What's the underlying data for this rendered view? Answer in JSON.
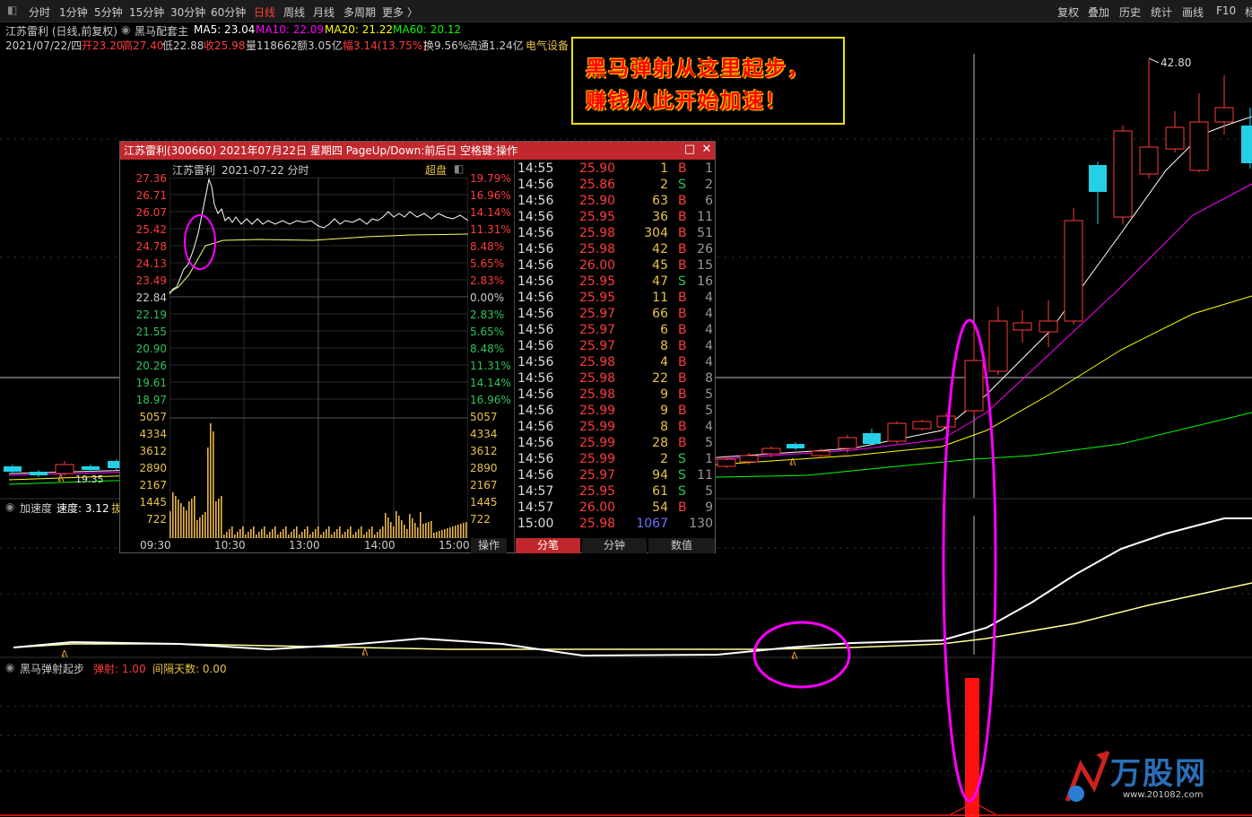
{
  "toolbar": {
    "left": [
      "分时",
      "1分钟",
      "5分钟",
      "15分钟",
      "30分钟",
      "60分钟",
      "日线",
      "周线",
      "月线",
      "多周期",
      "更多 〉"
    ],
    "right": [
      "复权",
      "叠加",
      "历史",
      "统计",
      "画线",
      "F10",
      "标"
    ],
    "active": "日线"
  },
  "info": {
    "title": "江苏雷利 (日线,前复权)",
    "formula": "黑马配套主",
    "ma5": "MA5: 23.04",
    "ma10": "MA10: 22.09",
    "ma20": "MA20: 21.22",
    "ma60": "MA60: 20.12",
    "date": "2021/07/22/四",
    "open": "开23.20",
    "high": "高27.40",
    "low": "低22.88",
    "close": "收25.98",
    "volume": "量118662",
    "amount": "额3.05亿",
    "range": "幅3.14(13.75%)",
    "turnover": "换9.56%",
    "float": "流通1.24亿",
    "sector": "电气设备"
  },
  "callout": {
    "line1": "黑马弹射从这里起步，",
    "line2": "赚钱从此开始加速！"
  },
  "chart_marks": {
    "peak": "42.80",
    "low": "19.35"
  },
  "panel2": {
    "title": "加速度",
    "speed": "速度: 3.12",
    "extra": "拔"
  },
  "panel3": {
    "title": "黑马弹射起步",
    "eject": "弹射: 1.00",
    "interval": "间隔天数: 0.00"
  },
  "colors": {
    "up": "#ff3b3b",
    "down": "#23d0e8",
    "ma5": "#ffffff",
    "ma10": "#ff00ff",
    "ma20": "#ffff00",
    "ma60": "#00ff00",
    "highlight": "#ff00ff"
  },
  "popup": {
    "title": "江苏雷利(300660) 2021年07月22日 星期四 PageUp/Down:前后日 空格键:操作",
    "header_name": "江苏雷利",
    "header_date": "2021-07-22 分时",
    "super_label": "超盘",
    "price_labels": [
      "27.36",
      "26.71",
      "26.07",
      "25.42",
      "24.78",
      "24.13",
      "23.49",
      "22.84",
      "22.19",
      "21.55",
      "20.90",
      "20.26",
      "19.61",
      "18.97"
    ],
    "pct_labels": [
      "19.79%",
      "16.96%",
      "14.14%",
      "11.31%",
      "8.48%",
      "5.65%",
      "2.83%",
      "0.00%",
      "2.83%",
      "5.65%",
      "8.48%",
      "11.31%",
      "14.14%",
      "16.96%"
    ],
    "volume_labels": [
      "5057",
      "4334",
      "3612",
      "2890",
      "2167",
      "1445",
      "722"
    ],
    "time_labels": [
      "09:30",
      "10:30",
      "13:00",
      "14:00",
      "15:00"
    ],
    "operate": "操作",
    "tabs": [
      "分笔",
      "分钟",
      "数值"
    ],
    "trades": [
      [
        "14:55",
        "25.90",
        "1",
        "B",
        "1"
      ],
      [
        "14:56",
        "25.86",
        "2",
        "S",
        "2"
      ],
      [
        "14:56",
        "25.90",
        "63",
        "B",
        "6"
      ],
      [
        "14:56",
        "25.95",
        "36",
        "B",
        "11"
      ],
      [
        "14:56",
        "25.98",
        "304",
        "B",
        "51"
      ],
      [
        "14:56",
        "25.98",
        "42",
        "B",
        "26"
      ],
      [
        "14:56",
        "26.00",
        "45",
        "B",
        "15"
      ],
      [
        "14:56",
        "25.95",
        "47",
        "S",
        "16"
      ],
      [
        "14:56",
        "25.95",
        "11",
        "B",
        "4"
      ],
      [
        "14:56",
        "25.97",
        "66",
        "B",
        "4"
      ],
      [
        "14:56",
        "25.97",
        "6",
        "B",
        "4"
      ],
      [
        "14:56",
        "25.97",
        "8",
        "B",
        "4"
      ],
      [
        "14:56",
        "25.98",
        "4",
        "B",
        "4"
      ],
      [
        "14:56",
        "25.98",
        "22",
        "B",
        "8"
      ],
      [
        "14:56",
        "25.98",
        "9",
        "B",
        "5"
      ],
      [
        "14:56",
        "25.99",
        "9",
        "B",
        "5"
      ],
      [
        "14:56",
        "25.99",
        "8",
        "B",
        "4"
      ],
      [
        "14:56",
        "25.99",
        "28",
        "B",
        "5"
      ],
      [
        "14:56",
        "25.99",
        "2",
        "S",
        "1"
      ],
      [
        "14:56",
        "25.97",
        "94",
        "S",
        "11"
      ],
      [
        "14:57",
        "25.95",
        "61",
        "S",
        "5"
      ],
      [
        "14:57",
        "26.00",
        "54",
        "B",
        "9"
      ],
      [
        "15:00",
        "25.98",
        "1067",
        "",
        "130"
      ]
    ]
  },
  "watermark": {
    "brand": "万股网",
    "url": "www.201082.com"
  }
}
